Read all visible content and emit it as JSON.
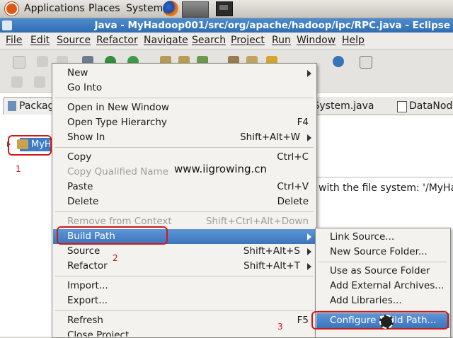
{
  "gnome_panel": {
    "menus": [
      "Applications",
      "Places",
      "System"
    ],
    "icons": [
      "ubuntu-logo-icon",
      "firefox-icon",
      "launcher-icon",
      "terminal-icon"
    ]
  },
  "window": {
    "title": "Java - MyHadoop001/src/org/apache/hadoop/ipc/RPC.java - Eclipse"
  },
  "menubar": [
    "File",
    "Edit",
    "Source",
    "Refactor",
    "Navigate",
    "Search",
    "Project",
    "Run",
    "Window",
    "Help"
  ],
  "views": {
    "package_tab": "Packag",
    "project_label": "MyH",
    "editor_tabs": [
      "leSystem.java",
      "DataNode"
    ],
    "console_text": "with the file system: '/MyHadoo",
    "watermark": "www.iigrowing.cn"
  },
  "annotations": [
    "1",
    "2",
    "3"
  ],
  "context_menu": {
    "items": [
      {
        "label": "New",
        "accel": "",
        "submenu": true,
        "disabled": false
      },
      {
        "label": "Go Into",
        "accel": "",
        "submenu": false,
        "disabled": false
      },
      {
        "label": "Open in New Window",
        "accel": "",
        "submenu": false,
        "disabled": false
      },
      {
        "label": "Open Type Hierarchy",
        "accel": "F4",
        "submenu": false,
        "disabled": false
      },
      {
        "label": "Show In",
        "accel": "Shift+Alt+W",
        "submenu": true,
        "disabled": false
      },
      {
        "label": "Copy",
        "accel": "Ctrl+C",
        "submenu": false,
        "disabled": false
      },
      {
        "label": "Copy Qualified Name",
        "accel": "",
        "submenu": false,
        "disabled": true
      },
      {
        "label": "Paste",
        "accel": "Ctrl+V",
        "submenu": false,
        "disabled": false
      },
      {
        "label": "Delete",
        "accel": "Delete",
        "submenu": false,
        "disabled": false
      },
      {
        "label": "Remove from Context",
        "accel": "Shift+Ctrl+Alt+Down",
        "submenu": false,
        "disabled": true
      },
      {
        "label": "Build Path",
        "accel": "",
        "submenu": true,
        "disabled": false,
        "highlighted": true
      },
      {
        "label": "Source",
        "accel": "Shift+Alt+S",
        "submenu": true,
        "disabled": false
      },
      {
        "label": "Refactor",
        "accel": "Shift+Alt+T",
        "submenu": true,
        "disabled": false
      },
      {
        "label": "Import...",
        "accel": "",
        "submenu": false,
        "disabled": false
      },
      {
        "label": "Export...",
        "accel": "",
        "submenu": false,
        "disabled": false
      },
      {
        "label": "Refresh",
        "accel": "F5",
        "submenu": false,
        "disabled": false
      },
      {
        "label": "Close Project",
        "accel": "",
        "submenu": false,
        "disabled": false
      }
    ]
  },
  "build_path_submenu": {
    "items": [
      {
        "label": "Link Source..."
      },
      {
        "label": "New Source Folder..."
      },
      {
        "label": "Use as Source Folder"
      },
      {
        "label": "Add External Archives..."
      },
      {
        "label": "Add Libraries..."
      },
      {
        "label": "Configure Build Path...",
        "highlighted": true
      }
    ]
  },
  "colors": {
    "title_bar": "#3b7bc1",
    "menu_highlight": "#4a85c8",
    "annotation_red": "#d01818"
  }
}
